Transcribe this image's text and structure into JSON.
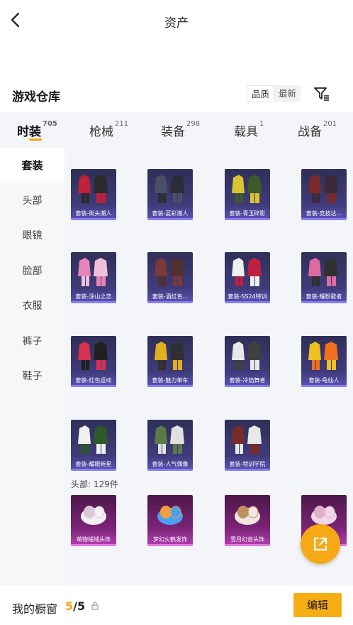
{
  "header": {
    "title": "资产"
  },
  "section": {
    "title": "游戏仓库"
  },
  "sort": {
    "options": [
      "品质",
      "最新"
    ],
    "selected": "品质"
  },
  "tabs": [
    {
      "label": "时装",
      "count": "705",
      "active": true
    },
    {
      "label": "枪械",
      "count": "211",
      "active": false
    },
    {
      "label": "装备",
      "count": "298",
      "active": false
    },
    {
      "label": "载具",
      "count": "1",
      "active": false
    },
    {
      "label": "战备",
      "count": "201",
      "active": false
    }
  ],
  "sidebar": {
    "items": [
      {
        "label": "套装",
        "active": true
      },
      {
        "label": "头部",
        "active": false
      },
      {
        "label": "眼镜",
        "active": false
      },
      {
        "label": "脸部",
        "active": false
      },
      {
        "label": "衣服",
        "active": false
      },
      {
        "label": "裤子",
        "active": false
      },
      {
        "label": "鞋子",
        "active": false
      }
    ]
  },
  "outfits": [
    "套装-街头潮人",
    "套装-蓝彩潮人",
    "套装-青玉碎影",
    "套装-竞技达...",
    "套装-涂山之恋",
    "套装-酒红色...",
    "套装-SS24特训",
    "套装-耀粉歌者",
    "套装-红色运动",
    "套装-魅力单车",
    "套装-冷焰舞者",
    "套装-龟仙人",
    "套装-耀眼新星",
    "套装-人气偶像",
    "套装-特训学院"
  ],
  "head_section": {
    "label": "头部: 129件"
  },
  "head_items": [
    "萌物绒绒头饰",
    "梦幻火鹤发饰",
    "雪月幻音头饰",
    ""
  ],
  "footer": {
    "wardrobe_label": "我的橱窗",
    "wardrobe_current": "5",
    "wardrobe_sep": "/",
    "wardrobe_total": "5",
    "edit_label": "编辑"
  },
  "colors": {
    "accent": "#f7ad14",
    "card_purple": "#3f3b7a",
    "card_magenta": "#7b2478"
  },
  "icons": [
    "back-arrow-icon",
    "filter-icon",
    "share-icon",
    "lock-icon"
  ]
}
